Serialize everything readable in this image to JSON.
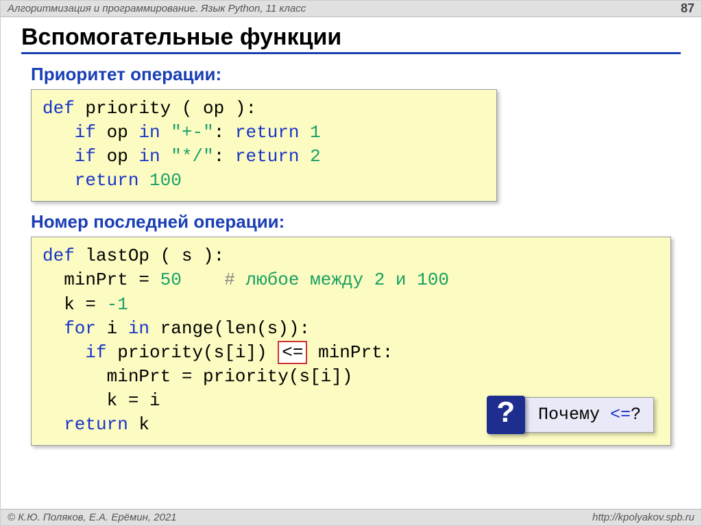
{
  "header": {
    "course": "Алгоритмизация и программирование. Язык Python, 11 класс",
    "page": "87"
  },
  "title": "Вспомогательные функции",
  "section1": {
    "heading": "Приоритет операции:",
    "code": {
      "l1a": "def",
      "l1b": " priority ( op ):",
      "l2a": "   if",
      "l2b": " op ",
      "l2c": "in",
      "l2d": " ",
      "l2e": "\"+-\"",
      "l2f": ": ",
      "l2g": "return",
      "l2h": " ",
      "l2i": "1",
      "l3a": "   if",
      "l3b": " op ",
      "l3c": "in",
      "l3d": " ",
      "l3e": "\"*/\"",
      "l3f": ": ",
      "l3g": "return",
      "l3h": " ",
      "l3i": "2",
      "l4a": "   return",
      "l4b": " ",
      "l4c": "100"
    }
  },
  "section2": {
    "heading": "Номер последней операции:",
    "code": {
      "l1a": "def",
      "l1b": " lastOp ( s ):",
      "l2a": "  minPrt = ",
      "l2b": "50",
      "l2c": "    # ",
      "l2d": "любое между 2 и 100",
      "l3a": "  k = ",
      "l3b": "-1",
      "l4a": "  for",
      "l4b": " i ",
      "l4c": "in",
      "l4d": " range(len(s)):",
      "l5a": "    if",
      "l5b": " priority(s[i]) ",
      "l5c": "<=",
      "l5d": " minPrt:",
      "l6": "      minPrt = priority(s[i])",
      "l7": "      k = i",
      "l8a": "  return",
      "l8b": " k"
    }
  },
  "callout": {
    "mark": "?",
    "text_pre": "Почему ",
    "op": "<=",
    "text_post": "?"
  },
  "footer": {
    "left": "© К.Ю. Поляков, Е.А. Ерёмин, 2021",
    "right": "http://kpolyakov.spb.ru"
  }
}
